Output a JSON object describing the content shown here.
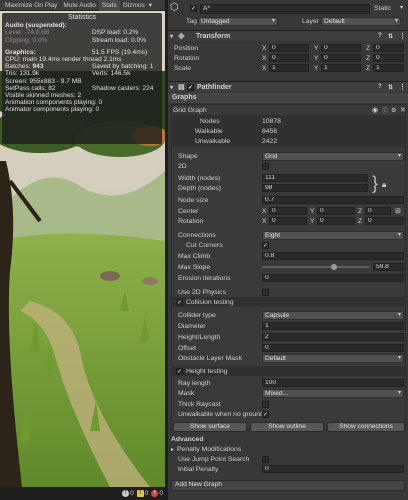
{
  "game": {
    "toolbar": [
      "Maximize On Play",
      "Mute Audio",
      "Stats",
      "Gizmos"
    ],
    "stats": {
      "title": "Statistics",
      "audio_header": "Audio (suspended):",
      "level": "Level: -74.8 dB",
      "clipping": "Clipping: 0.0%",
      "dsp": "DSP load: 0.2%",
      "stream": "Stream load: 0.0%",
      "graphics_header": "Graphics:",
      "fps": "51.5 FPS (19.4ms)",
      "cpu": "CPU: main 19.4ms  render thread 2.1ms",
      "batches_label": "Batches: ",
      "batches_value": "943",
      "saved_batching": "Saved by batching: 1",
      "tris": "Tris: 131.9k",
      "verts": "Verts: 146.5k",
      "screen": "Screen: 955x883 - 9.7 MB",
      "setpass": "SetPass calls: 82",
      "shadow": "Shadow casters: 224",
      "skinned": "Visible skinned meshes: 2",
      "anim": "Animation components playing: 0",
      "animator": "Animator components playing: 0"
    },
    "status_counts": [
      "0",
      "0",
      "0"
    ]
  },
  "inspector": {
    "name": "A*",
    "static_label": "Static",
    "tag_label": "Tag",
    "tag_value": "Untagged",
    "layer_label": "Layer",
    "layer_value": "Default",
    "transform": {
      "title": "Transform",
      "rows": [
        {
          "label": "Position",
          "x": "0",
          "y": "0",
          "z": "0"
        },
        {
          "label": "Rotation",
          "x": "0",
          "y": "0",
          "z": "0"
        },
        {
          "label": "Scale",
          "x": "1",
          "y": "1",
          "z": "1"
        }
      ]
    },
    "pathfinder": {
      "title": "Pathfinder",
      "graphs_label": "Graphs",
      "grid_graph": "Grid Graph",
      "stats": [
        {
          "label": "Nodes",
          "value": "10878"
        },
        {
          "label": "Walkable",
          "value": "8456"
        },
        {
          "label": "Unwalkable",
          "value": "2422"
        }
      ],
      "shape_label": "Shape",
      "shape_value": "Grid",
      "twod_label": "2D",
      "width_label": "Width (nodes)",
      "width_value": "111",
      "depth_label": "Depth (nodes)",
      "depth_value": "98",
      "nodesize_label": "Node size",
      "nodesize_value": "0.7",
      "center_label": "Center",
      "center": {
        "x": "0",
        "y": "0",
        "z": "0"
      },
      "rotation_label": "Rotation",
      "rotation": {
        "x": "0",
        "y": "0",
        "z": "0"
      },
      "connections_label": "Connections",
      "connections_value": "Eight",
      "cutcorners_label": "Cut Corners",
      "maxclimb_label": "Max Climb",
      "maxclimb_value": "0.8",
      "maxslope_label": "Max Slope",
      "maxslope_value": "59.8",
      "maxslope_fraction": 0.665,
      "erosion_label": "Erosion iterations",
      "erosion_value": "0",
      "use2d_label": "Use 2D Physics",
      "collision_label": "Collision testing",
      "collider_label": "Collider type",
      "collider_value": "Capsule",
      "diameter_label": "Diameter",
      "diameter_value": "1",
      "height_label": "Height/Length",
      "height_value": "2",
      "offset_label": "Offset",
      "offset_value": "0",
      "obstacle_label": "Obstacle Layer Mask",
      "obstacle_value": "Default",
      "heighttest_label": "Height testing",
      "raylength_label": "Ray length",
      "raylength_value": "100",
      "mask_label": "Mask",
      "mask_value": "Mixed...",
      "thick_label": "Thick Raycast",
      "unwalkable_label": "Unwalkable when no ground",
      "buttons": [
        "Show surface",
        "Show outline",
        "Show connections"
      ],
      "advanced_label": "Advanced",
      "penalty_label": "Penalty Modifications",
      "jump_label": "Use Jump Point Search",
      "initial_label": "Initial Penalty",
      "initial_value": "0",
      "add_graph": "Add New Graph"
    }
  }
}
